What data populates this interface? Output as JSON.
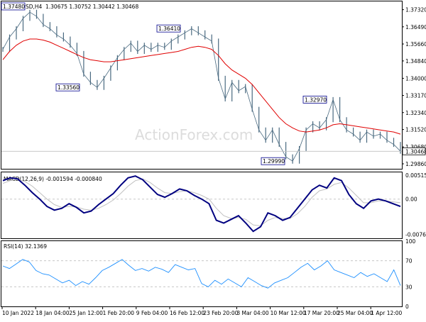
{
  "header": {
    "symbol": "GBPUSD,H4",
    "ohlc": "1.30675 1.30752 1.30442 1.30468"
  },
  "watermark": "ActionForex.com",
  "colors": {
    "price": "#4a6a80",
    "ma": "#e00000",
    "macd_main": "#000080",
    "macd_signal": "#c0c0c0",
    "rsi": "#1e90ff",
    "label_border": "#00008b",
    "label_text": "#000080"
  },
  "chart_data": [
    {
      "type": "line",
      "panel": "price",
      "y_ticks": [
        "1.37320",
        "1.36490",
        "1.35660",
        "1.34840",
        "1.34000",
        "1.33170",
        "1.32340",
        "1.31520",
        "1.30680",
        "1.29860"
      ],
      "ylim": [
        1.2962,
        1.3772
      ],
      "last_price": "1.30468",
      "x_ticks": [
        "10 Jan 2022",
        "18 Jan 04:00",
        "25 Jan 12:00",
        "1 Feb 20:00",
        "9 Feb 04:00",
        "16 Feb 12:00",
        "23 Feb 20:00",
        "3 Mar 04:00",
        "10 Mar 12:00",
        "17 Mar 20:00",
        "25 Mar 04:00",
        "1 Apr 12:00"
      ],
      "series": [
        {
          "values": [
            1.354,
            1.36,
            1.364,
            1.369,
            1.372,
            1.37,
            1.366,
            1.364,
            1.361,
            1.359,
            1.356,
            1.352,
            1.342,
            1.338,
            1.3356,
            1.34,
            1.345,
            1.35,
            1.354,
            1.357,
            1.353,
            1.356,
            1.354,
            1.356,
            1.355,
            1.358,
            1.36,
            1.362,
            1.364,
            1.362,
            1.36,
            1.358,
            1.34,
            1.33,
            1.338,
            1.334,
            1.336,
            1.325,
            1.315,
            1.31,
            1.315,
            1.308,
            1.302,
            1.2999,
            1.306,
            1.315,
            1.318,
            1.316,
            1.32,
            1.3297,
            1.32,
            1.315,
            1.313,
            1.31,
            1.314,
            1.312,
            1.313,
            1.31,
            1.308,
            1.3047
          ]
        },
        {
          "values": [
            1.349,
            1.353,
            1.356,
            1.358,
            1.359,
            1.359,
            1.3585,
            1.3575,
            1.356,
            1.3545,
            1.353,
            1.3515,
            1.35,
            1.349,
            1.3485,
            1.348,
            1.348,
            1.3485,
            1.349,
            1.3495,
            1.35,
            1.3505,
            1.351,
            1.3515,
            1.352,
            1.3525,
            1.353,
            1.354,
            1.355,
            1.3555,
            1.355,
            1.354,
            1.351,
            1.347,
            1.344,
            1.342,
            1.34,
            1.337,
            1.333,
            1.329,
            1.325,
            1.321,
            1.318,
            1.316,
            1.3145,
            1.314,
            1.3145,
            1.315,
            1.316,
            1.3175,
            1.318,
            1.3175,
            1.317,
            1.3165,
            1.316,
            1.3155,
            1.315,
            1.3145,
            1.314,
            1.313
          ]
        }
      ],
      "annotations": [
        "1.37480",
        "1.36410",
        "1.33560",
        "1.32970",
        "1.29990"
      ]
    },
    {
      "type": "line",
      "panel": "macd",
      "title": "MACD(12,26,9) -0.001594 -0.000840",
      "y_ticks": [
        "0.005152",
        "0.00",
        "-0.00765"
      ],
      "ylim": [
        -0.0085,
        0.0058
      ],
      "series": [
        {
          "values": [
            0.004,
            0.0046,
            0.0044,
            0.003,
            0.0014,
            0.0,
            -0.0016,
            -0.0024,
            -0.002,
            -0.001,
            -0.0018,
            -0.003,
            -0.0026,
            -0.0012,
            0.0,
            0.0012,
            0.003,
            0.0046,
            0.005,
            0.0042,
            0.0026,
            0.001,
            0.0004,
            0.0012,
            0.0022,
            0.0018,
            0.0008,
            0.0,
            -0.001,
            -0.0046,
            -0.0052,
            -0.0044,
            -0.0036,
            -0.0052,
            -0.007,
            -0.006,
            -0.003,
            -0.0036,
            -0.0046,
            -0.004,
            -0.002,
            0.0,
            0.002,
            0.003,
            0.0024,
            0.0046,
            0.004,
            0.001,
            -0.001,
            -0.002,
            -0.0004,
            0.0,
            -0.0004,
            -0.001,
            -0.0016
          ]
        },
        {
          "values": [
            0.0034,
            0.004,
            0.0043,
            0.0038,
            0.0028,
            0.0014,
            0.0,
            -0.0012,
            -0.0018,
            -0.0016,
            -0.0017,
            -0.0022,
            -0.0024,
            -0.002,
            -0.0012,
            -0.0002,
            0.0012,
            0.0028,
            0.004,
            0.0044,
            0.0036,
            0.0024,
            0.0014,
            0.0012,
            0.0016,
            0.0018,
            0.0014,
            0.0008,
            0.0,
            -0.002,
            -0.0036,
            -0.0042,
            -0.004,
            -0.0044,
            -0.0056,
            -0.0058,
            -0.0046,
            -0.004,
            -0.0042,
            -0.0042,
            -0.0032,
            -0.0016,
            0.0004,
            0.0018,
            0.0022,
            0.0032,
            0.0036,
            0.0024,
            0.0008,
            -0.0008,
            -0.0008,
            -0.0004,
            -0.0004,
            -0.0006,
            -0.0008
          ]
        }
      ]
    },
    {
      "type": "line",
      "panel": "rsi",
      "title": "RSI(14) 32.1369",
      "y_ticks": [
        "100",
        "70",
        "30",
        "0"
      ],
      "ylim": [
        0,
        100
      ],
      "series": [
        {
          "values": [
            62,
            58,
            65,
            72,
            68,
            55,
            50,
            48,
            42,
            36,
            40,
            32,
            38,
            34,
            44,
            55,
            60,
            66,
            72,
            63,
            55,
            58,
            54,
            60,
            57,
            52,
            64,
            60,
            56,
            58,
            35,
            30,
            40,
            34,
            42,
            36,
            30,
            44,
            38,
            32,
            28,
            36,
            40,
            44,
            52,
            60,
            66,
            56,
            62,
            70,
            56,
            52,
            48,
            44,
            52,
            46,
            50,
            44,
            38,
            56,
            32
          ]
        }
      ]
    }
  ]
}
